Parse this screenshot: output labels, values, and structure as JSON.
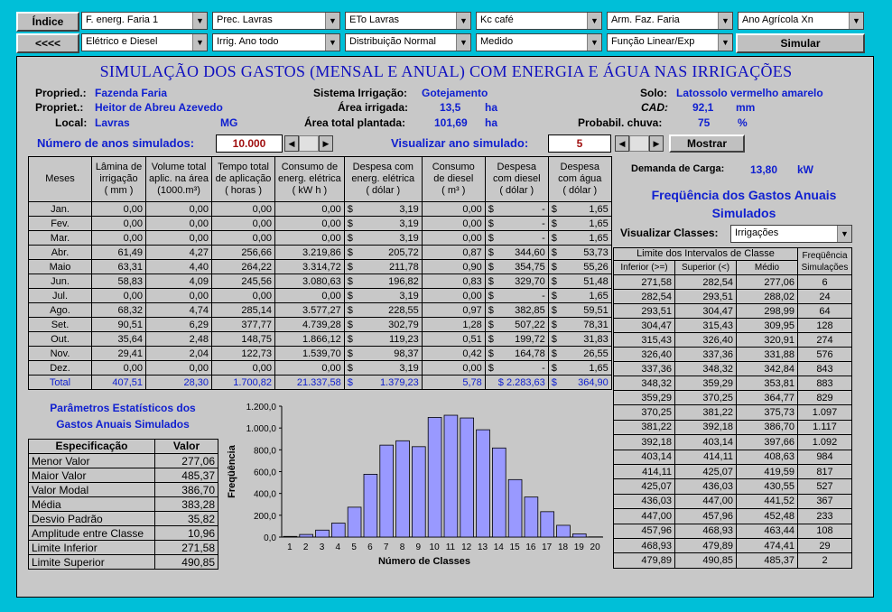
{
  "top": {
    "indice": "Índice",
    "back": "<<<<",
    "simular": "Simular",
    "combos": [
      "F. energ. Faria 1",
      "Prec. Lavras",
      "ETo Lavras",
      "Kc café",
      "Arm. Faz. Faria",
      "Ano Agrícola Xn",
      "Elétrico e Diesel",
      "Irrig. Ano todo",
      "Distribuição Normal",
      "Medido",
      "Função Linear/Exp"
    ]
  },
  "title": "SIMULAÇÃO DOS GASTOS (MENSAL E ANUAL) COM ENERGIA E ÁGUA NAS IRRIGAÇÕES",
  "info": {
    "propried_l": "Propried.:",
    "propried_v": "Fazenda Faria",
    "propriet_l": "Propriet.:",
    "propriet_v": "Heitor de Abreu Azevedo",
    "local_l": "Local:",
    "local_v": "Lavras",
    "uf": "MG",
    "sistema_l": "Sistema Irrigação:",
    "sistema_v": "Gotejamento",
    "area_l": "Área irrigada:",
    "area_v": "13,5",
    "area_u": "ha",
    "areat_l": "Área total plantada:",
    "areat_v": "101,69",
    "areat_u": "ha",
    "solo_l": "Solo:",
    "solo_v": "Latossolo vermelho amarelo",
    "cad_l": "CAD:",
    "cad_v": "92,1",
    "cad_u": "mm",
    "prob_l": "Probabil. chuva:",
    "prob_v": "75",
    "prob_u": "%"
  },
  "sim": {
    "anos_l": "Número de anos simulados:",
    "anos_v": "10.000",
    "ver_l": "Visualizar ano simulado:",
    "ver_v": "5",
    "mostrar": "Mostrar"
  },
  "monthly": {
    "headers": [
      [
        "Meses"
      ],
      [
        "Lâmina de",
        "irrigação",
        "( mm )"
      ],
      [
        "Volume total",
        "aplic. na área",
        "(1000.m³)"
      ],
      [
        "Tempo total",
        "de aplicação",
        "( horas )"
      ],
      [
        "Consumo de",
        "energ. elétrica",
        "( kW h )"
      ],
      [
        "Despesa  com",
        "energ. elétrica",
        "( dólar )"
      ],
      [
        "Consumo",
        "de diesel",
        "( m³ )"
      ],
      [
        "Despesa",
        "com diesel",
        "( dólar )"
      ],
      [
        "Despesa",
        "com água",
        "( dólar )"
      ]
    ],
    "rows": [
      [
        "Jan.",
        "0,00",
        "0,00",
        "0,00",
        "0,00",
        "$",
        "3,19",
        "0,00",
        "$",
        "-",
        "$",
        "1,65"
      ],
      [
        "Fev.",
        "0,00",
        "0,00",
        "0,00",
        "0,00",
        "$",
        "3,19",
        "0,00",
        "$",
        "-",
        "$",
        "1,65"
      ],
      [
        "Mar.",
        "0,00",
        "0,00",
        "0,00",
        "0,00",
        "$",
        "3,19",
        "0,00",
        "$",
        "-",
        "$",
        "1,65"
      ],
      [
        "Abr.",
        "61,49",
        "4,27",
        "256,66",
        "3.219,86",
        "$",
        "205,72",
        "0,87",
        "$",
        "344,60",
        "$",
        "53,73"
      ],
      [
        "Maio",
        "63,31",
        "4,40",
        "264,22",
        "3.314,72",
        "$",
        "211,78",
        "0,90",
        "$",
        "354,75",
        "$",
        "55,26"
      ],
      [
        "Jun.",
        "58,83",
        "4,09",
        "245,56",
        "3.080,63",
        "$",
        "196,82",
        "0,83",
        "$",
        "329,70",
        "$",
        "51,48"
      ],
      [
        "Jul.",
        "0,00",
        "0,00",
        "0,00",
        "0,00",
        "$",
        "3,19",
        "0,00",
        "$",
        "-",
        "$",
        "1,65"
      ],
      [
        "Ago.",
        "68,32",
        "4,74",
        "285,14",
        "3.577,27",
        "$",
        "228,55",
        "0,97",
        "$",
        "382,85",
        "$",
        "59,51"
      ],
      [
        "Set.",
        "90,51",
        "6,29",
        "377,77",
        "4.739,28",
        "$",
        "302,79",
        "1,28",
        "$",
        "507,22",
        "$",
        "78,31"
      ],
      [
        "Out.",
        "35,64",
        "2,48",
        "148,75",
        "1.866,12",
        "$",
        "119,23",
        "0,51",
        "$",
        "199,72",
        "$",
        "31,83"
      ],
      [
        "Nov.",
        "29,41",
        "2,04",
        "122,73",
        "1.539,70",
        "$",
        "98,37",
        "0,42",
        "$",
        "164,78",
        "$",
        "26,55"
      ],
      [
        "Dez.",
        "0,00",
        "0,00",
        "0,00",
        "0,00",
        "$",
        "3,19",
        "0,00",
        "$",
        "-",
        "$",
        "1,65"
      ]
    ],
    "total": [
      "Total",
      "407,51",
      "28,30",
      "1.700,82",
      "21.337,58",
      "$",
      "1.379,23",
      "5,78",
      "$ 2.283,63",
      "$",
      "364,90"
    ]
  },
  "demanda": {
    "label": "Demanda de Carga:",
    "value": "13,80",
    "unit": "kW"
  },
  "freq": {
    "title1": "Freqüência dos Gastos Anuais",
    "title2": "Simulados",
    "vis_l": "Visualizar Classes:",
    "vis_v": "Irrigações",
    "lim_h": "Limite dos Intervalos de Classe",
    "freq_h": "Freqüência",
    "sim_h": "Simulações",
    "inf_h": "Inferior (>=)",
    "sup_h": "Superior (<)",
    "med_h": "Médio",
    "rows": [
      [
        "271,58",
        "282,54",
        "277,06",
        "6"
      ],
      [
        "282,54",
        "293,51",
        "288,02",
        "24"
      ],
      [
        "293,51",
        "304,47",
        "298,99",
        "64"
      ],
      [
        "304,47",
        "315,43",
        "309,95",
        "128"
      ],
      [
        "315,43",
        "326,40",
        "320,91",
        "274"
      ],
      [
        "326,40",
        "337,36",
        "331,88",
        "576"
      ],
      [
        "337,36",
        "348,32",
        "342,84",
        "843"
      ],
      [
        "348,32",
        "359,29",
        "353,81",
        "883"
      ],
      [
        "359,29",
        "370,25",
        "364,77",
        "829"
      ],
      [
        "370,25",
        "381,22",
        "375,73",
        "1.097"
      ],
      [
        "381,22",
        "392,18",
        "386,70",
        "1.117"
      ],
      [
        "392,18",
        "403,14",
        "397,66",
        "1.092"
      ],
      [
        "403,14",
        "414,11",
        "408,63",
        "984"
      ],
      [
        "414,11",
        "425,07",
        "419,59",
        "817"
      ],
      [
        "425,07",
        "436,03",
        "430,55",
        "527"
      ],
      [
        "436,03",
        "447,00",
        "441,52",
        "367"
      ],
      [
        "447,00",
        "457,96",
        "452,48",
        "233"
      ],
      [
        "457,96",
        "468,93",
        "463,44",
        "108"
      ],
      [
        "468,93",
        "479,89",
        "474,41",
        "29"
      ],
      [
        "479,89",
        "490,85",
        "485,37",
        "2"
      ]
    ]
  },
  "stats": {
    "title1": "Parâmetros Estatísticos dos",
    "title2": "Gastos Anuais Simulados",
    "spec_h": "Especificação",
    "val_h": "Valor",
    "rows": [
      [
        "Menor Valor",
        "277,06"
      ],
      [
        "Maior Valor",
        "485,37"
      ],
      [
        "Valor Modal",
        "386,70"
      ],
      [
        "Média",
        "383,28"
      ],
      [
        "Desvio  Padrão",
        "35,82"
      ],
      [
        "Amplitude entre Classe",
        "10,96"
      ],
      [
        "Limite Inferior",
        "271,58"
      ],
      [
        "Limite Superior",
        "490,85"
      ]
    ]
  },
  "chart_data": {
    "type": "bar",
    "xlabel": "Número de Classes",
    "ylabel": "Freqüência",
    "categories": [
      "1",
      "2",
      "3",
      "4",
      "5",
      "6",
      "7",
      "8",
      "9",
      "10",
      "11",
      "12",
      "13",
      "14",
      "15",
      "16",
      "17",
      "18",
      "19",
      "20"
    ],
    "values": [
      6,
      24,
      64,
      128,
      274,
      576,
      843,
      883,
      829,
      1097,
      1117,
      1092,
      984,
      817,
      527,
      367,
      233,
      108,
      29,
      2
    ],
    "ylim": [
      0,
      1200
    ],
    "yticks": [
      "0,0",
      "200,0",
      "400,0",
      "600,0",
      "800,0",
      "1.000,0",
      "1.200,0"
    ],
    "bar_color": "#9999FF"
  }
}
